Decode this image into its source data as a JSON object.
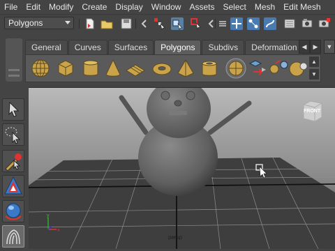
{
  "menu": [
    "File",
    "Edit",
    "Modify",
    "Create",
    "Display",
    "Window",
    "Assets",
    "Select",
    "Mesh",
    "Edit Mesh"
  ],
  "status_line": {
    "mode": "Polygons"
  },
  "shelf_tabs": [
    {
      "label": "General",
      "active": false
    },
    {
      "label": "Curves",
      "active": false
    },
    {
      "label": "Surfaces",
      "active": false
    },
    {
      "label": "Polygons",
      "active": true
    },
    {
      "label": "Subdivs",
      "active": false
    },
    {
      "label": "Deformation",
      "active": false
    }
  ],
  "shelf_icons": [
    "poly-sphere-icon",
    "poly-cube-icon",
    "poly-cylinder-icon",
    "poly-cone-icon",
    "poly-plane-icon",
    "poly-torus-icon",
    "poly-pyramid-icon",
    "poly-pipe-icon",
    "poly-helix-icon",
    "smooth-icon",
    "extract-icon",
    "combine-icon",
    "separate-icon",
    "mirror-icon"
  ],
  "toolbox": [
    "select-tool-icon",
    "lasso-tool-icon",
    "paint-select-tool-icon",
    "move-tool-icon",
    "rotate-tool-icon",
    "last-tool-icon"
  ],
  "viewport": {
    "camera_label": "persp",
    "viewcube_label": "FRONT",
    "colors": {
      "background_top": "#b9b9b9",
      "background_bottom": "#3f3f3f",
      "grid": "#ffffff",
      "object": "#6b6b6b"
    }
  }
}
